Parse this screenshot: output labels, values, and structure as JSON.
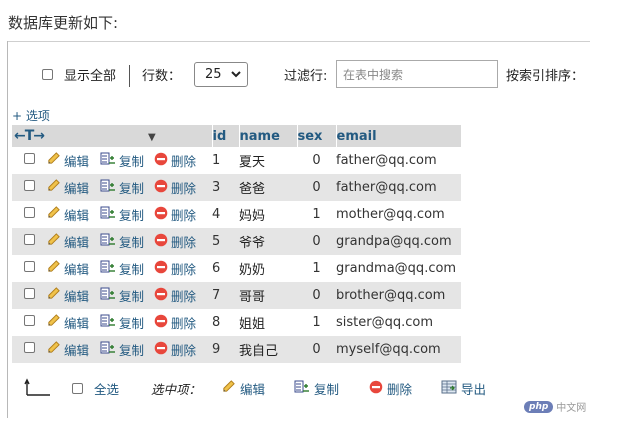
{
  "heading": "数据库更新如下:",
  "toolbar": {
    "show_all_label": "显示全部",
    "rows_label": "行数：",
    "rows_value": "25",
    "filter_label": "过滤行:",
    "filter_placeholder": "在表中搜索",
    "sort_by_index_label": "按索引排序："
  },
  "options_link": "+ 选项",
  "table": {
    "columns": [
      "id",
      "name",
      "sex",
      "email"
    ],
    "action_labels": {
      "edit": "编辑",
      "copy": "复制",
      "delete": "删除"
    },
    "rows": [
      {
        "id": "1",
        "name": "夏天",
        "sex": "0",
        "email": "father@qq.com"
      },
      {
        "id": "3",
        "name": "爸爸",
        "sex": "0",
        "email": "father@qq.com"
      },
      {
        "id": "4",
        "name": "妈妈",
        "sex": "1",
        "email": "mother@qq.com"
      },
      {
        "id": "5",
        "name": "爷爷",
        "sex": "0",
        "email": "grandpa@qq.com"
      },
      {
        "id": "6",
        "name": "奶奶",
        "sex": "1",
        "email": "grandma@qq.com"
      },
      {
        "id": "7",
        "name": "哥哥",
        "sex": "0",
        "email": "brother@qq.com"
      },
      {
        "id": "8",
        "name": "姐姐",
        "sex": "1",
        "email": "sister@qq.com"
      },
      {
        "id": "9",
        "name": "我自己",
        "sex": "0",
        "email": "myself@qq.com"
      }
    ]
  },
  "footer": {
    "select_all": "全选",
    "with_selected": "选中项：",
    "edit": "编辑",
    "copy": "复制",
    "delete": "删除",
    "export": "导出"
  },
  "watermark": {
    "badge": "php",
    "text": "中文网"
  },
  "colors": {
    "link": "#235a81",
    "header_bg": "#d9d9d9",
    "row_alt_bg": "#e5e5e5",
    "delete_red": "#e8473c",
    "edit_pencil": "#e8b83a"
  },
  "icons": {
    "edit": "pencil-icon",
    "copy": "copy-icon",
    "delete": "delete-icon",
    "export": "export-icon"
  }
}
